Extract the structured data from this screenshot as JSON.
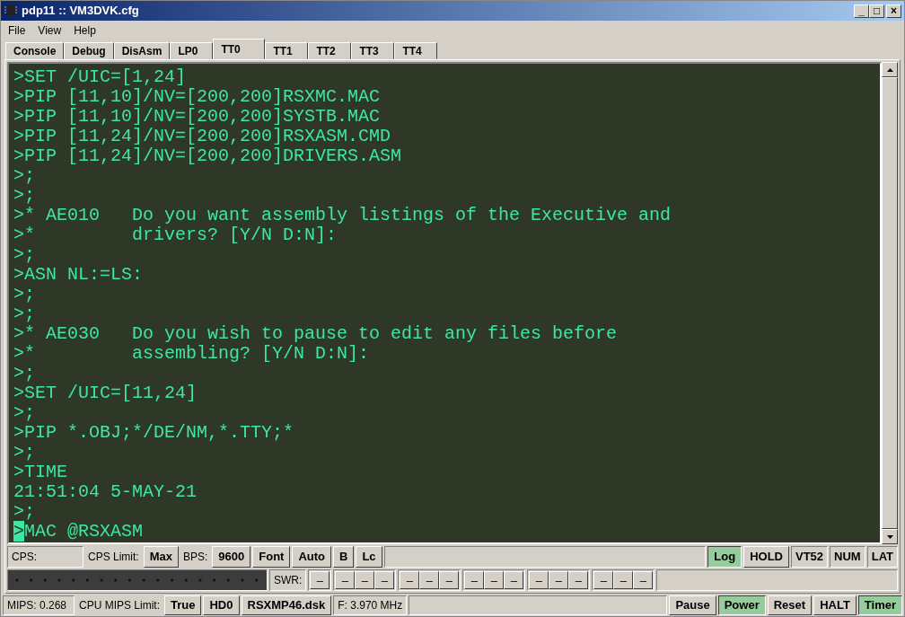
{
  "window": {
    "title": "pdp11 :: VM3DVK.cfg",
    "controls": [
      "_",
      "□",
      "×"
    ]
  },
  "menu": [
    "File",
    "View",
    "Help"
  ],
  "tabs": [
    {
      "label": "Console",
      "selected": false
    },
    {
      "label": "Debug",
      "selected": false
    },
    {
      "label": "DisAsm",
      "selected": false
    },
    {
      "label": "LP0",
      "selected": false
    },
    {
      "label": "TT0",
      "selected": true
    },
    {
      "label": "TT1",
      "selected": false
    },
    {
      "label": "TT2",
      "selected": false
    },
    {
      "label": "TT3",
      "selected": false
    },
    {
      "label": "TT4",
      "selected": false
    }
  ],
  "terminal": {
    "cursor_at_last_line_start": true,
    "lines": [
      ">SET /UIC=[1,24]",
      ">PIP [11,10]/NV=[200,200]RSXMC.MAC",
      ">PIP [11,10]/NV=[200,200]SYSTB.MAC",
      ">PIP [11,24]/NV=[200,200]RSXASM.CMD",
      ">PIP [11,24]/NV=[200,200]DRIVERS.ASM",
      ">;",
      ">;",
      ">* AE010   Do you want assembly listings of the Executive and",
      ">*         drivers? [Y/N D:N]:",
      ">;",
      ">ASN NL:=LS:",
      ">;",
      ">;",
      ">* AE030   Do you wish to pause to edit any files before",
      ">*         assembling? [Y/N D:N]:",
      ">;",
      ">SET /UIC=[11,24]",
      ">;",
      ">PIP *.OBJ;*/DE/NM,*.TTY;*",
      ">;",
      ">TIME",
      "21:51:04 5-MAY-21",
      ">;",
      ">MAC @RSXASM"
    ]
  },
  "terminal_bar": [
    {
      "kind": "panel",
      "text": "CPS:"
    },
    {
      "kind": "label",
      "text": "CPS Limit:"
    },
    {
      "kind": "button",
      "text": "Max"
    },
    {
      "kind": "label",
      "text": "BPS:"
    },
    {
      "kind": "button",
      "text": "9600"
    },
    {
      "kind": "button",
      "text": "Font"
    },
    {
      "kind": "button",
      "text": "Auto"
    },
    {
      "kind": "button",
      "text": "B"
    },
    {
      "kind": "button",
      "text": "Lc"
    },
    {
      "kind": "spacer"
    },
    {
      "kind": "toggle",
      "text": "Log",
      "on": true
    },
    {
      "kind": "button",
      "text": "HOLD"
    },
    {
      "kind": "indicator",
      "text": "VT52"
    },
    {
      "kind": "indicator",
      "text": "NUM"
    },
    {
      "kind": "indicator",
      "text": "LAT"
    }
  ],
  "switch_row": {
    "label": "SWR:",
    "groups": [
      [
        "–"
      ],
      [
        "–",
        "–",
        "–"
      ],
      [
        "–",
        "–",
        "–"
      ],
      [
        "–",
        "–",
        "–"
      ],
      [
        "–",
        "–",
        "–"
      ],
      [
        "–",
        "–",
        "–"
      ]
    ]
  },
  "status_bar": [
    {
      "kind": "panel",
      "text": "MIPS:  0.268"
    },
    {
      "kind": "label",
      "text": "CPU MIPS Limit:"
    },
    {
      "kind": "button",
      "text": "True"
    },
    {
      "kind": "button",
      "text": "HD0"
    },
    {
      "kind": "button",
      "text": "RSXMP46.dsk"
    },
    {
      "kind": "panel",
      "text": "F: 3.970 MHz"
    },
    {
      "kind": "spacer"
    },
    {
      "kind": "toggle",
      "text": "Pause",
      "on": false
    },
    {
      "kind": "toggle",
      "text": "Power",
      "on": true
    },
    {
      "kind": "toggle",
      "text": "Reset",
      "on": false
    },
    {
      "kind": "toggle",
      "text": "HALT",
      "on": false
    },
    {
      "kind": "toggle",
      "text": "Timer",
      "on": true
    }
  ]
}
